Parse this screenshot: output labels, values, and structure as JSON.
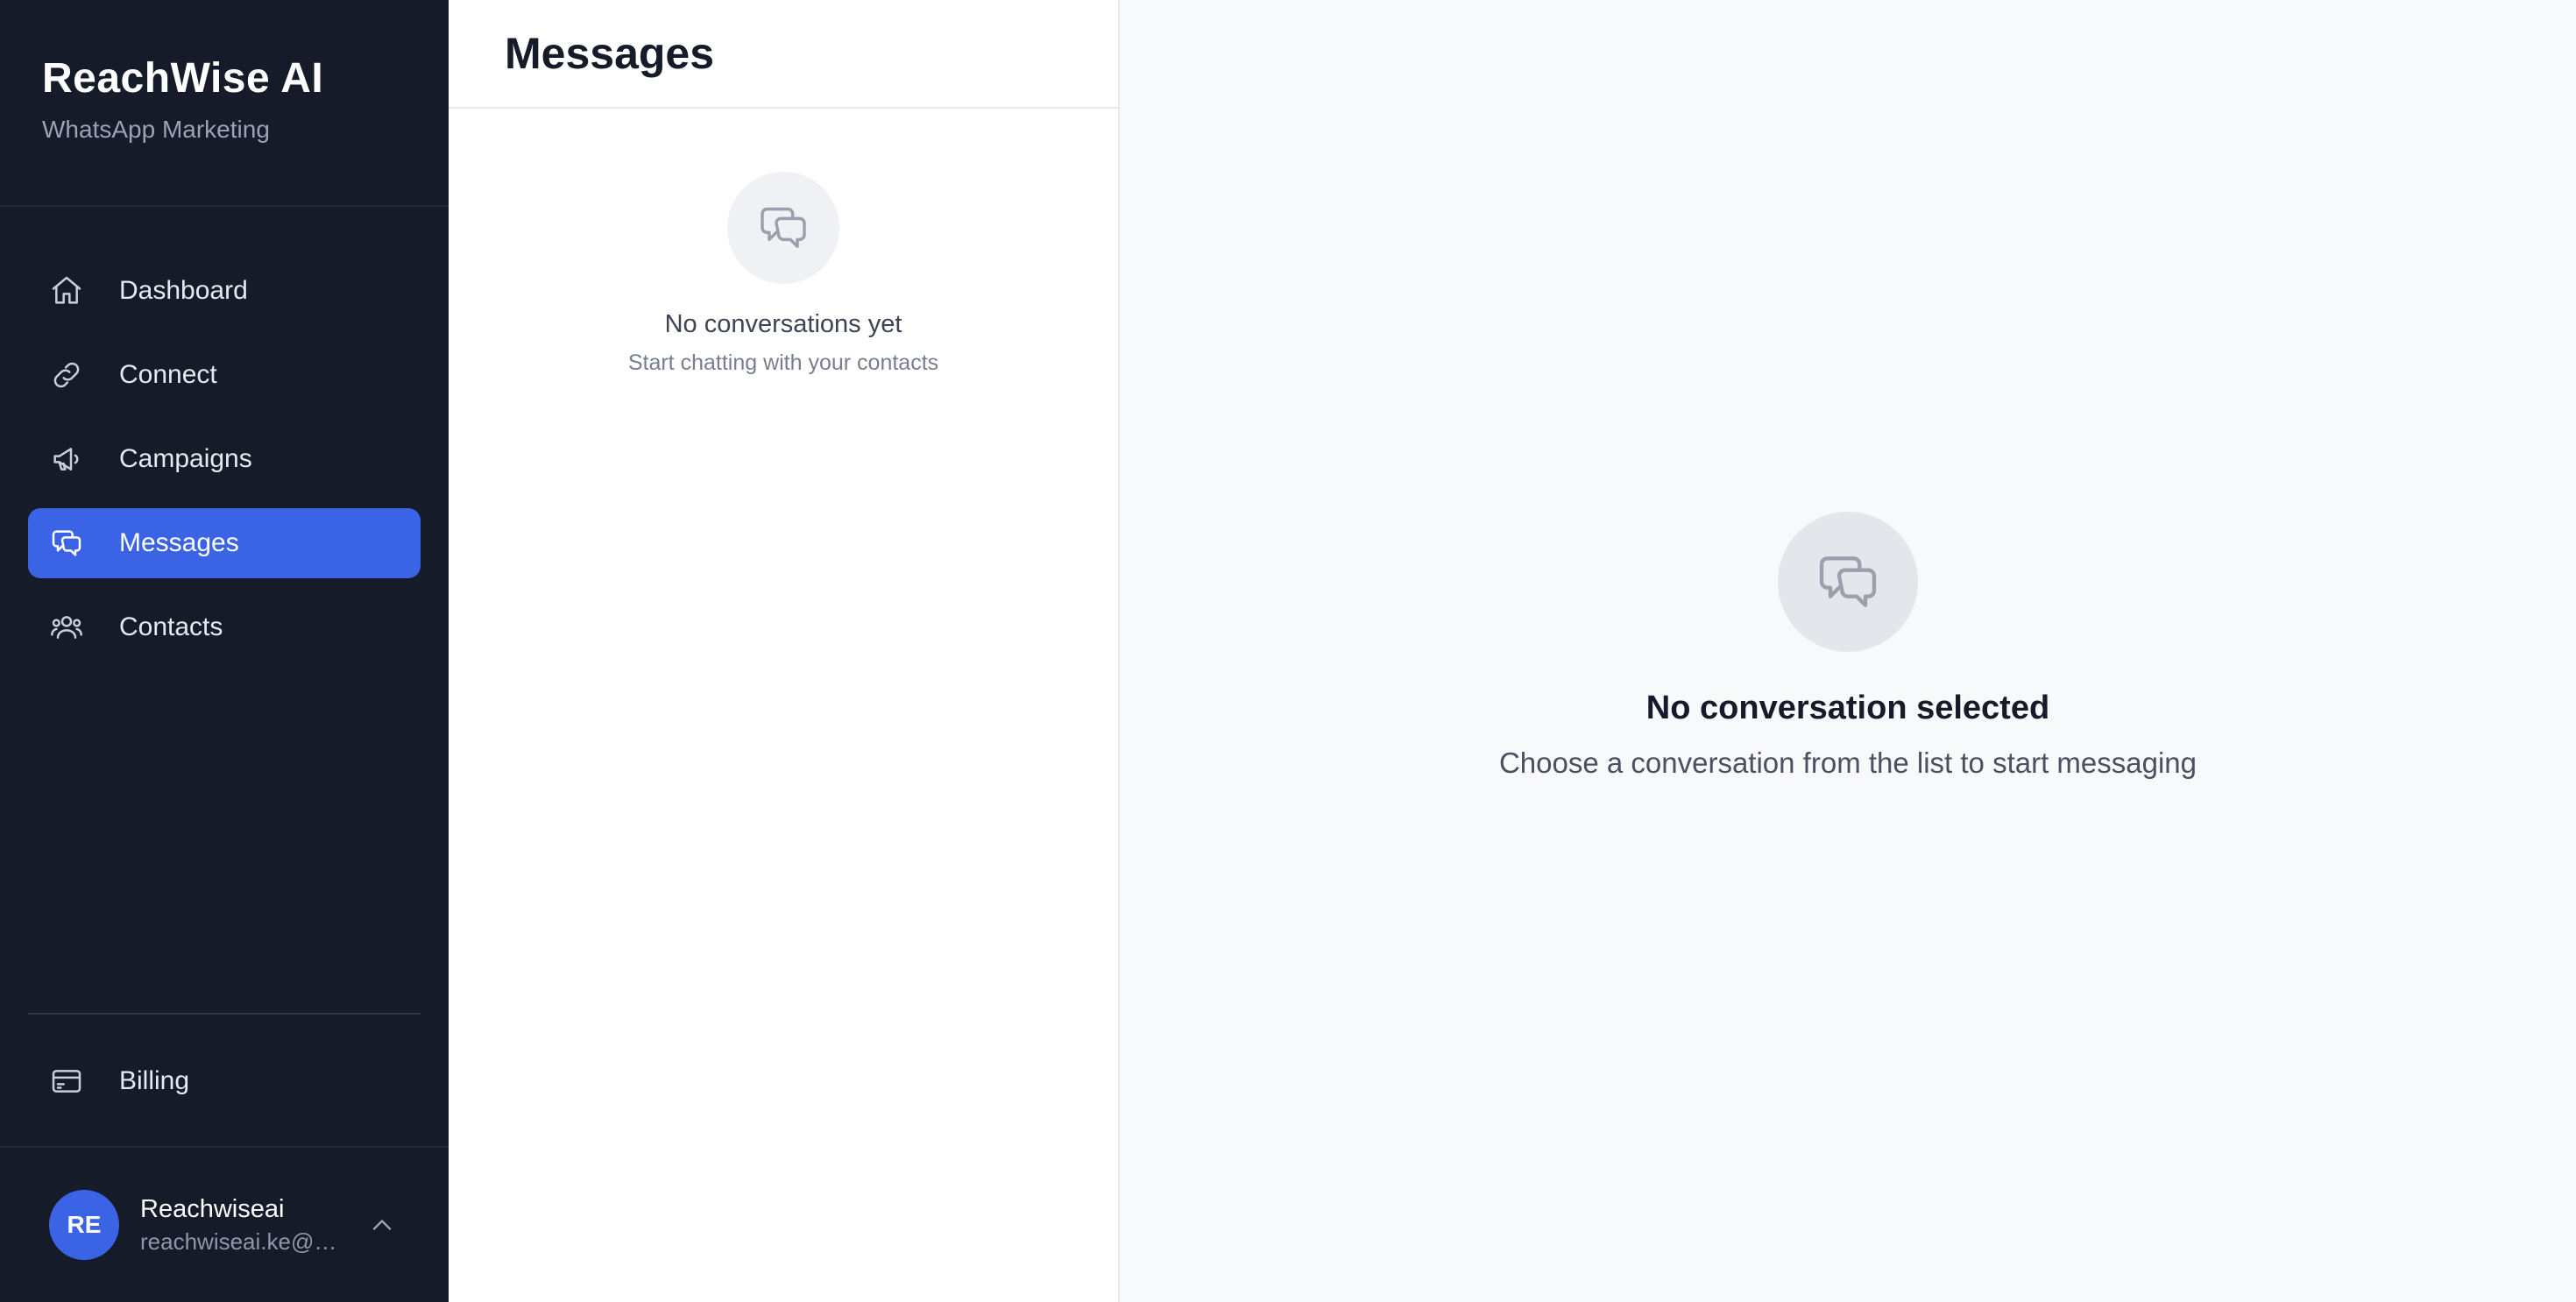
{
  "brand": {
    "title": "ReachWise AI",
    "subtitle": "WhatsApp Marketing"
  },
  "nav": {
    "items": [
      {
        "label": "Dashboard",
        "icon": "home-icon",
        "active": false
      },
      {
        "label": "Connect",
        "icon": "link-icon",
        "active": false
      },
      {
        "label": "Campaigns",
        "icon": "megaphone-icon",
        "active": false
      },
      {
        "label": "Messages",
        "icon": "chat-bubbles-icon",
        "active": true
      },
      {
        "label": "Contacts",
        "icon": "users-icon",
        "active": false
      }
    ],
    "billing": {
      "label": "Billing",
      "icon": "credit-card-icon"
    }
  },
  "user": {
    "initials": "RE",
    "name": "Reachwiseai",
    "email": "reachwiseai.ke@g..."
  },
  "list": {
    "title": "Messages",
    "empty_title": "No conversations yet",
    "empty_subtitle": "Start chatting with your contacts"
  },
  "main": {
    "empty_title": "No conversation selected",
    "empty_subtitle": "Choose a conversation from the list to start messaging"
  },
  "colors": {
    "sidebar_bg": "#161b29",
    "accent": "#3b63e6",
    "main_bg": "#f8f9fb"
  }
}
